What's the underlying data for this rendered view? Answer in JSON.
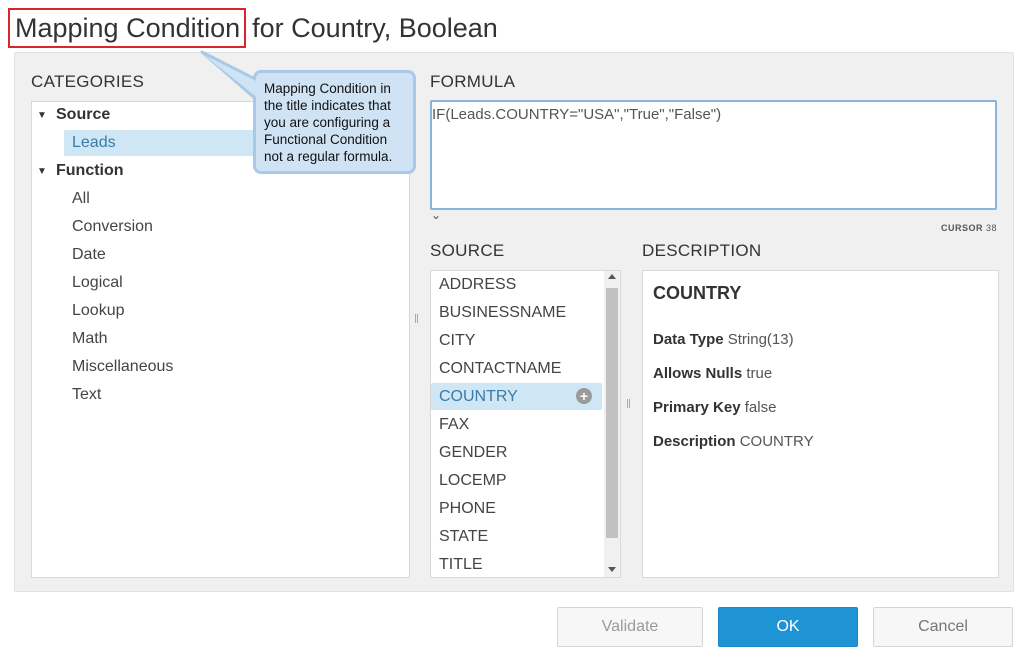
{
  "title": {
    "highlighted": "Mapping Condition",
    "rest": "for Country, Boolean"
  },
  "categories": {
    "label": "CATEGORIES",
    "groups": [
      {
        "label": "Source",
        "items": [
          "Leads"
        ]
      },
      {
        "label": "Function",
        "items": [
          "All",
          "Conversion",
          "Date",
          "Logical",
          "Lookup",
          "Math",
          "Miscellaneous",
          "Text"
        ]
      }
    ],
    "selected": "Leads"
  },
  "formula": {
    "label": "FORMULA",
    "value": "IF(Leads.COUNTRY=\"USA\",\"True\",\"False\")",
    "cursor_label": "CURSOR",
    "cursor_value": "38"
  },
  "source": {
    "label": "SOURCE",
    "items": [
      "ADDRESS",
      "BUSINESSNAME",
      "CITY",
      "CONTACTNAME",
      "COUNTRY",
      "FAX",
      "GENDER",
      "LOCEMP",
      "PHONE",
      "STATE",
      "TITLE"
    ],
    "selected": "COUNTRY",
    "add_icon": "plus-circle-icon"
  },
  "description": {
    "label": "DESCRIPTION",
    "title": "COUNTRY",
    "rows": [
      {
        "key": "Data Type",
        "value": "String(13)"
      },
      {
        "key": "Allows Nulls",
        "value": "true"
      },
      {
        "key": "Primary Key",
        "value": "false"
      },
      {
        "key": "Description",
        "value": "COUNTRY"
      }
    ]
  },
  "callout": {
    "text": "Mapping Condition in the title indicates that you are configuring a Functional Condition not a regular formula."
  },
  "buttons": {
    "validate": "Validate",
    "ok": "OK",
    "cancel": "Cancel"
  },
  "colors": {
    "accent": "#1e94d4",
    "selection_bg": "#cfe6f4",
    "highlight_border": "#d9262c",
    "callout_bg": "#cfe3f5"
  }
}
